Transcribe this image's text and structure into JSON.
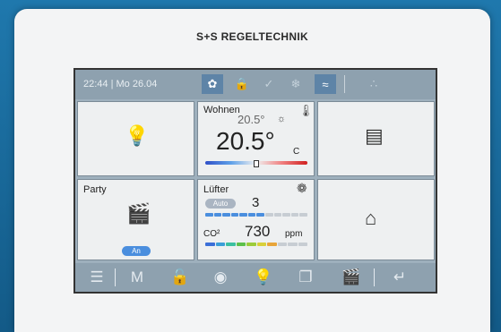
{
  "brand": "S+S REGELTECHNIK",
  "status": {
    "datetime": "22:44 | Mo 26.04",
    "icons": [
      "leaf-icon",
      "lock-icon",
      "check-icon",
      "snowflake-icon",
      "heat-icon",
      "drops-icon"
    ]
  },
  "tiles": {
    "light": {
      "icon": "lightbulb-icon"
    },
    "room": {
      "label": "Wohnen",
      "setpoint": "20.5°",
      "temperature": "20.5°",
      "unit": "C",
      "level": 0.5
    },
    "blinds": {
      "icon": "blinds-icon"
    },
    "party": {
      "label": "Party",
      "badge": "An"
    },
    "fan": {
      "label": "Lüfter",
      "mode": "Auto",
      "value": "3",
      "level": 0.6
    },
    "co2": {
      "label": "CO²",
      "value": "730",
      "unit": "ppm",
      "level": 0.72
    },
    "presence": {
      "icon": "home-person-icon"
    }
  },
  "bottom": {
    "m_label": "M"
  },
  "colors": {
    "active": "#5e84a7",
    "accent": "#4a8ede",
    "bar": "#8ea1af"
  }
}
